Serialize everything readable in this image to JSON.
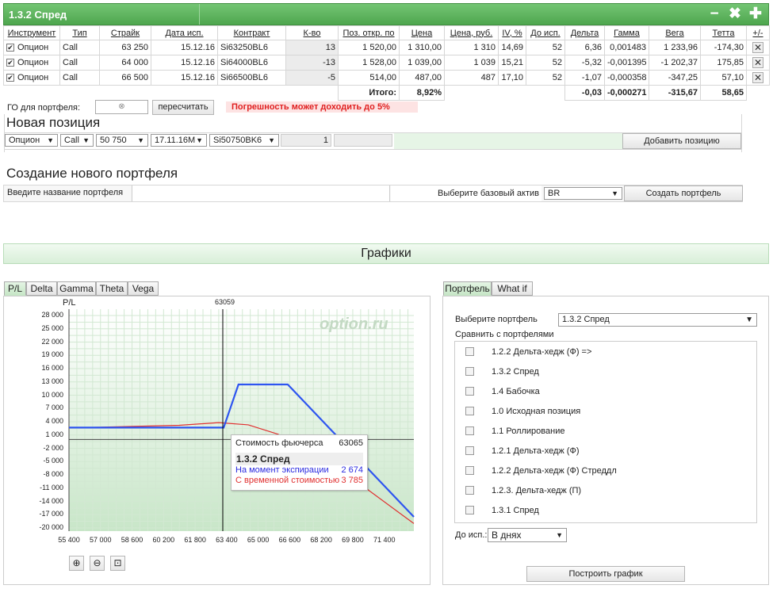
{
  "header": {
    "title": "1.3.2 Спред",
    "ctl_min": "−",
    "ctl_close": "✖",
    "ctl_add": "✚"
  },
  "table": {
    "columns": [
      "Инструмент",
      "Тип",
      "Страйк",
      "Дата исп.",
      "Контракт",
      "К-во",
      "Поз. откр. по",
      "Цена",
      "Цена, руб.",
      "IV, %",
      "До исп.",
      "Дельта",
      "Гамма",
      "Вега",
      "Тетта",
      "+/-"
    ],
    "rows": [
      [
        "Опцион",
        "Call",
        "63 250",
        "15.12.16",
        "Si63250BL6",
        "13",
        "1 520,00",
        "1 310,00",
        "1 310",
        "14,69",
        "52",
        "6,36",
        "0,001483",
        "1 233,96",
        "-174,30"
      ],
      [
        "Опцион",
        "Call",
        "64 000",
        "15.12.16",
        "Si64000BL6",
        "-13",
        "1 528,00",
        "1 039,00",
        "1 039",
        "15,21",
        "52",
        "-5,32",
        "-0,001395",
        "-1 202,37",
        "175,85"
      ],
      [
        "Опцион",
        "Call",
        "66 500",
        "15.12.16",
        "Si66500BL6",
        "-5",
        "514,00",
        "487,00",
        "487",
        "17,10",
        "52",
        "-1,07",
        "-0,000358",
        "-347,25",
        "57,10"
      ]
    ],
    "total_label": "Итого:",
    "total_price": "8,92%",
    "total_delta": "-0,03",
    "total_gamma": "-0,000271",
    "total_vega": "-315,67",
    "total_theta": "58,65"
  },
  "go": {
    "label": "ГО для портфеля:",
    "recalc": "пересчитать",
    "warning": "Погрешность может доходить до 5%"
  },
  "new_position": {
    "title": "Новая позиция",
    "instrument": "Опцион",
    "type": "Call",
    "strike": "50 750",
    "date": "17.11.16M",
    "contract": "Si50750BK6",
    "qty": "1",
    "add_button": "Добавить позицию"
  },
  "new_portfolio": {
    "title": "Создание нового портфеля",
    "name_placeholder": "Введите название портфеля",
    "asset_label": "Выберите базовый актив",
    "asset_value": "BR",
    "create_button": "Создать портфель"
  },
  "charts_title": "Графики",
  "chart_tabs": [
    "P/L",
    "Delta",
    "Gamma",
    "Theta",
    "Vega"
  ],
  "chart": {
    "ylabel": "P/L",
    "watermark": "option.ru",
    "marker_label": "63059",
    "tooltip": {
      "header_label": "Стоимость фьючерса",
      "header_value": "63065",
      "title": "1.3.2 Спред",
      "row1_label": "На момент экспирации",
      "row1_value": "2 674",
      "row2_label": "С временной стоимостью",
      "row2_value": "3 785",
      "row1_color": "#2a2ae0",
      "row2_color": "#e03030"
    }
  },
  "chart_data": {
    "type": "line",
    "xlim": [
      55400,
      72900
    ],
    "ylim": [
      -20000,
      29000
    ],
    "x_ticks": [
      "55 400",
      "57 000",
      "58 600",
      "60 200",
      "61 800",
      "63 400",
      "65 000",
      "66 600",
      "68 200",
      "69 800",
      "71 400"
    ],
    "y_ticks": [
      "28 000",
      "25 000",
      "22 000",
      "19 000",
      "16 000",
      "13 000",
      "10 000",
      "7 000",
      "4 000",
      "1 000",
      "-2 000",
      "-5 000",
      "-8 000",
      "-11 000",
      "-14 000",
      "-17 000",
      "-20 000"
    ],
    "series": [
      {
        "name": "На момент экспирации",
        "color": "#2e55f0",
        "x": [
          55400,
          63250,
          64000,
          66500,
          72900
        ],
        "y": [
          2674,
          2674,
          12424,
          12424,
          -17500
        ]
      },
      {
        "name": "С временной стоимостью",
        "color": "#e03030",
        "x": [
          55400,
          61000,
          63000,
          64500,
          66000,
          68000,
          70000,
          72900
        ],
        "y": [
          2600,
          3200,
          3800,
          3300,
          1200,
          -3000,
          -9500,
          -19000
        ]
      }
    ]
  },
  "zoom": {
    "in": "zoom-in",
    "out": "zoom-out",
    "fit": "zoom-fit"
  },
  "right": {
    "tabs": [
      "Портфель",
      "What if"
    ],
    "select_label": "Выберите портфель",
    "select_value": "1.3.2 Спред",
    "compare_label": "Сравнить с портфелями",
    "portfolios": [
      "1.2.2 Дельта-хедж (Ф) =>",
      "1.3.2 Спред",
      "1.4 Бабочка",
      "1.0 Исходная позиция",
      "1.1 Роллирование",
      "1.2.1 Дельта-хедж (Ф)",
      "1.2.2 Дельта-хедж (Ф) Стреддл",
      "1.2.3. Дельта-хедж (П)",
      "1.3.1 Спред"
    ],
    "exp_label": "До исп.:",
    "exp_value": "В днях",
    "build_button": "Построить график"
  }
}
